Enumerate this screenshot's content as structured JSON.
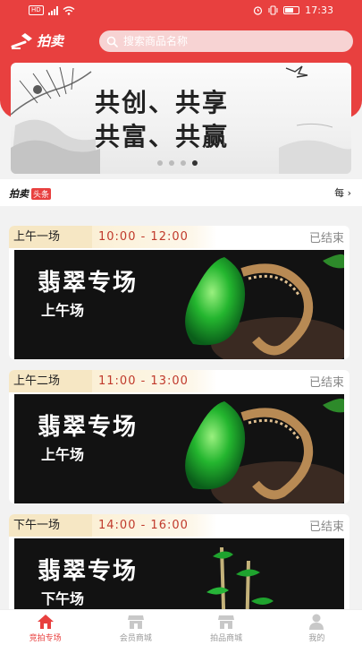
{
  "status_bar": {
    "time": "17:33",
    "network": "HD"
  },
  "header": {
    "logo_text": "拍卖",
    "search_placeholder": "搜索商品名称"
  },
  "banner": {
    "line1": "共创、共享",
    "line2": "共富、共赢",
    "dots": 4,
    "active_dot": 3
  },
  "news": {
    "logo_text": "拍卖",
    "logo_badge": "头条",
    "more_text": "每"
  },
  "sessions": [
    {
      "name": "上午一场",
      "time": "10:00 - 12:00",
      "status": "已结束",
      "title": "翡翠专场",
      "subtitle": "上午场"
    },
    {
      "name": "上午二场",
      "time": "11:00 - 13:00",
      "status": "已结束",
      "title": "翡翠专场",
      "subtitle": "上午场"
    },
    {
      "name": "下午一场",
      "time": "14:00 - 16:00",
      "status": "已结束",
      "title": "翡翠专场",
      "subtitle": "下午场"
    }
  ],
  "tabbar": [
    {
      "label": "竞拍专场",
      "icon": "home-icon",
      "active": true
    },
    {
      "label": "会员商城",
      "icon": "store-icon",
      "active": false
    },
    {
      "label": "拍品商城",
      "icon": "store-icon",
      "active": false
    },
    {
      "label": "我的",
      "icon": "user-icon",
      "active": false
    }
  ],
  "colors": {
    "brand": "#e8403f",
    "time_text": "#c0392b",
    "jade": "#1fa32e"
  }
}
